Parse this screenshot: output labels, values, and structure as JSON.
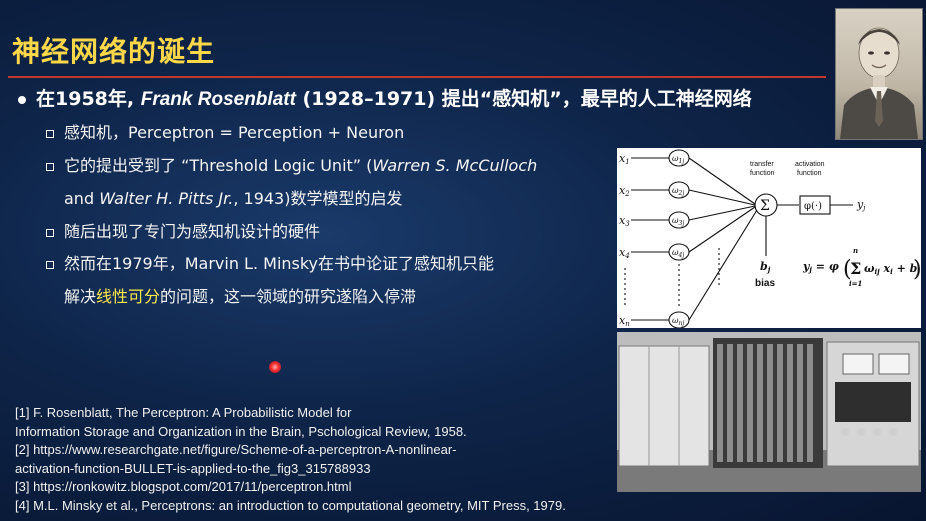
{
  "title": "神经网络的诞生",
  "main_bullet": {
    "prefix": "在1958年, ",
    "name": "Frank Rosenblatt",
    "years": " (1928–1971) 提出“感知机”，最早的人工神经网络"
  },
  "bullets": [
    {
      "text": "感知机，Perceptron = Perception + Neuron"
    },
    {
      "a": "它的提出受到了 “Threshold Logic Unit” (",
      "b": "Warren S. McCulloch",
      "c": ""
    },
    {
      "a": "and ",
      "b": "Walter H. Pitts Jr.",
      "c": ", 1943)数学模型的启发"
    },
    {
      "text": "随后出现了专门为感知机设计的硬件"
    },
    {
      "text": "然而在1979年，Marvin L. Minsky在书中论证了感知机只能"
    },
    {
      "a": "解决",
      "b": "线性可分",
      "c": "的问题，这一领域的研究遂陷入停滞"
    }
  ],
  "references": [
    "[1] F. Rosenblatt, The Perceptron: A Probabilistic Model for",
    "Information Storage and Organization in the Brain, Pschological Review, 1958.",
    "[2] https://www.researchgate.net/figure/Scheme-of-a-perceptron-A-nonlinear-",
    "activation-function-BULLET-is-applied-to-the_fig3_315788933",
    "[3] https://ronkowitz.blogspot.com/2017/11/perceptron.html",
    "[4] M.L. Minsky et al., Perceptrons: an introduction to computational geometry, MIT Press, 1979."
  ],
  "diagram": {
    "inputs": [
      "x1",
      "x2",
      "x3",
      "x4",
      "xn"
    ],
    "weights": [
      "ω1j",
      "ω2j",
      "ω3j",
      "ω4j",
      "ωnj"
    ],
    "transfer_label": "transfer\nfunction",
    "activation_label": "activation\nfunction",
    "sum_symbol": "Σ",
    "phi_box": "φ(·)",
    "output": "yj",
    "bias_var": "bj",
    "bias_label": "bias",
    "formula": "yj = φ( Σ ωij xi + bj )",
    "sum_upper": "n",
    "sum_lower": "i=1"
  },
  "colors": {
    "title": "#ffd84a",
    "rule": "#c0392b",
    "highlight": "#ffe94d",
    "laser": "#ff2a2a"
  }
}
